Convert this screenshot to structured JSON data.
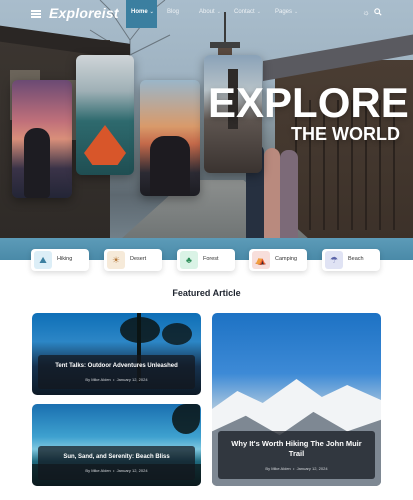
{
  "nav": {
    "logo": "Exploreist",
    "items": [
      {
        "label": "Home",
        "active": true
      },
      {
        "label": "Blog",
        "active": false
      },
      {
        "label": "About",
        "active": false
      },
      {
        "label": "Contact",
        "active": false
      },
      {
        "label": "Pages",
        "active": false
      }
    ],
    "icons": [
      "menu-icon",
      "sun-icon",
      "search-icon"
    ]
  },
  "hero": {
    "headline": "EXPLORE",
    "subheadline": "THE WORLD"
  },
  "categories": [
    {
      "label": "Hiking",
      "icon": "hiking-icon",
      "color": "#dceef7"
    },
    {
      "label": "Desert",
      "icon": "desert-icon",
      "color": "#f6ead9"
    },
    {
      "label": "Forest",
      "icon": "forest-icon",
      "color": "#daf3e6"
    },
    {
      "label": "Camping",
      "icon": "camping-icon",
      "color": "#f7dedb"
    },
    {
      "label": "Beach",
      "icon": "beach-icon",
      "color": "#e0e3f4"
    }
  ],
  "featured": {
    "title": "Featured Article",
    "articles": [
      {
        "title": "Tent Talks: Outdoor Adventures Unleashed",
        "author": "By Mike Alden",
        "date": "January 12, 2024"
      },
      {
        "title": "Sun, Sand, and Serenity: Beach Bliss",
        "author": "By Mike Alden",
        "date": "January 12, 2024"
      },
      {
        "title": "Why It's Worth Hiking The John Muir Trail",
        "author": "By Mike Alden",
        "date": "January 12, 2024"
      }
    ]
  },
  "colors": {
    "accent": "#3b7fa0",
    "hero_band": "#4a8aa8",
    "title": "#1f2530"
  }
}
